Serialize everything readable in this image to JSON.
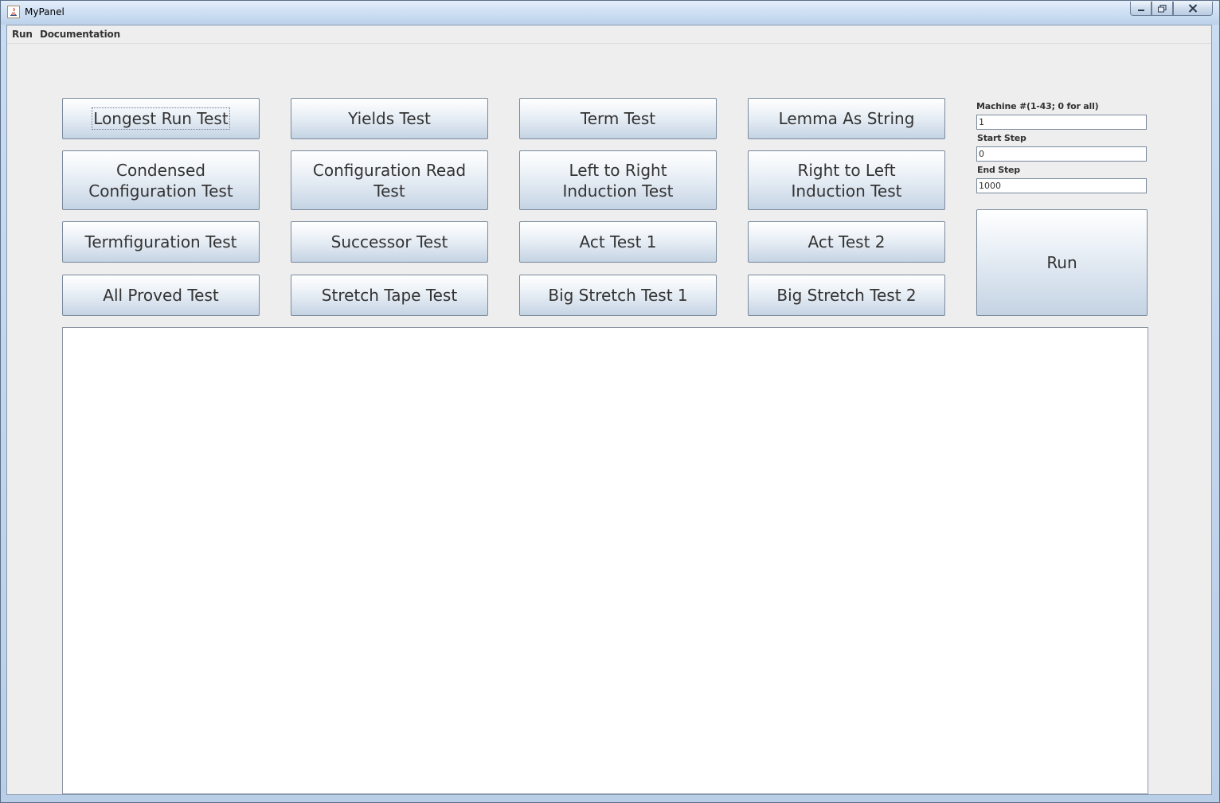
{
  "window": {
    "title": "MyPanel"
  },
  "menubar": {
    "items": [
      {
        "label": "Run"
      },
      {
        "label": "Documentation"
      }
    ]
  },
  "tests": [
    {
      "label": "Longest Run Test",
      "focused": true
    },
    {
      "label": "Yields Test"
    },
    {
      "label": "Term Test"
    },
    {
      "label": "Lemma As String"
    },
    {
      "label": "Condensed Configuration Test"
    },
    {
      "label": "Configuration Read Test"
    },
    {
      "label": "Left to Right Induction Test"
    },
    {
      "label": "Right to Left Induction Test"
    },
    {
      "label": "Termfiguration Test"
    },
    {
      "label": "Successor Test"
    },
    {
      "label": "Act Test 1"
    },
    {
      "label": "Act Test 2"
    },
    {
      "label": "All Proved Test"
    },
    {
      "label": "Stretch Tape Test"
    },
    {
      "label": "Big Stretch Test 1"
    },
    {
      "label": "Big Stretch Test 2"
    }
  ],
  "params": {
    "machine_label": "Machine #(1-43; 0 for all)",
    "machine_value": "1",
    "start_label": "Start Step",
    "start_value": "0",
    "end_label": "End Step",
    "end_value": "1000"
  },
  "run_button": {
    "label": "Run"
  },
  "output": {
    "text": ""
  }
}
